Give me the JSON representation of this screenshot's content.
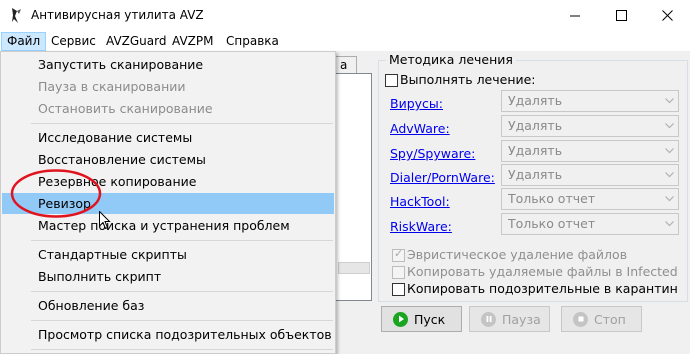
{
  "window": {
    "title": "Антивирусная утилита AVZ",
    "minimize_glyph": "—",
    "maximize_glyph": "☐",
    "close_glyph": "✕"
  },
  "menubar": {
    "items": [
      {
        "label": "Файл"
      },
      {
        "label": "Сервис"
      },
      {
        "label": "AVZGuard"
      },
      {
        "label": "AVZPM"
      },
      {
        "label": "Справка"
      }
    ],
    "active": "Файл"
  },
  "file_menu": {
    "items": [
      {
        "label": "Запустить сканирование",
        "enabled": true
      },
      {
        "label": "Пауза в сканировании",
        "enabled": false
      },
      {
        "label": "Остановить сканирование",
        "enabled": false
      },
      {
        "label": "Исследование системы",
        "enabled": true
      },
      {
        "label": "Восстановление системы",
        "enabled": true
      },
      {
        "label": "Резервное копирование",
        "enabled": true
      },
      {
        "label": "Ревизор",
        "enabled": true,
        "highlighted": true
      },
      {
        "label": "Мастер поиска и устранения проблем",
        "enabled": true
      },
      {
        "label": "Стандартные скрипты",
        "enabled": true
      },
      {
        "label": "Выполнить скрипт",
        "enabled": true
      },
      {
        "label": "Обновление баз",
        "enabled": true
      },
      {
        "label": "Просмотр списка подозрительных объектов",
        "enabled": true
      }
    ],
    "annotation_color": "#e0141e"
  },
  "background_tab_fragment": "a",
  "treatment": {
    "title": "Методика лечения",
    "perform_treatment_label": "Выполнять лечение:",
    "perform_treatment_checked": false,
    "categories": [
      {
        "label": "Вирусы:",
        "value": "Удалять"
      },
      {
        "label": "AdvWare:",
        "value": "Удалять"
      },
      {
        "label": "Spy/Spyware:",
        "value": "Удалять"
      },
      {
        "label": "Dialer/PornWare:",
        "value": "Удалять"
      },
      {
        "label": "HackTool:",
        "value": "Только отчет"
      },
      {
        "label": "RiskWare:",
        "value": "Только отчет"
      }
    ],
    "heuristic_label": "Эвристическое удаление файлов",
    "heuristic_checked": true,
    "copy_deleted_label": "Копировать удаляемые файлы в  Infected",
    "copy_deleted_checked": false,
    "copy_suspicious_label": "Копировать подозрительные в  карантин",
    "copy_suspicious_checked": false
  },
  "actions": {
    "start": {
      "label": "Пуск",
      "enabled": true,
      "icon": "play-icon",
      "color": "#1aa521"
    },
    "pause": {
      "label": "Пауза",
      "enabled": false,
      "icon": "pause-icon"
    },
    "stop": {
      "label": "Стоп",
      "enabled": false,
      "icon": "stop-icon"
    }
  },
  "colors": {
    "menu_highlight": "#91c9f7",
    "menubar_active": "#cce8ff",
    "link": "#0000ee"
  }
}
